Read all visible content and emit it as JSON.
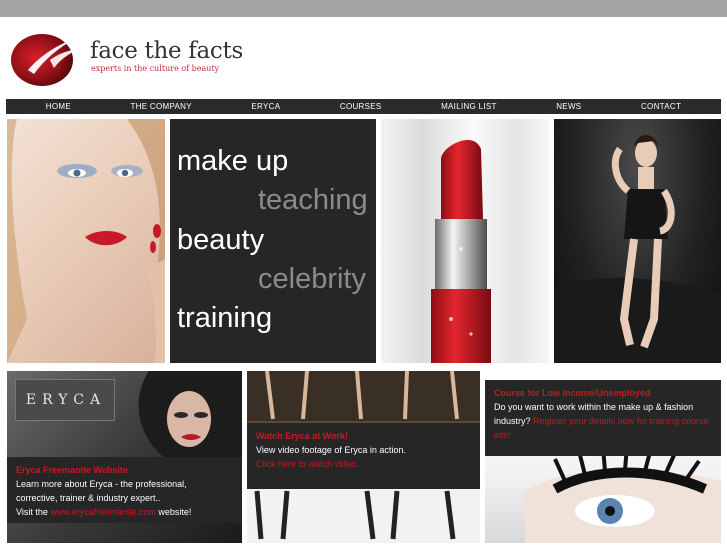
{
  "logo": {
    "title": "face the facts",
    "tagline": "experts in the culture of beauty"
  },
  "nav": {
    "items": [
      "HOME",
      "THE COMPANY",
      "ERYCA",
      "COURSES",
      "MAILING LIST",
      "NEWS",
      "CONTACT"
    ]
  },
  "hero": {
    "words": [
      "make up",
      "teaching",
      "beauty",
      "celebrity",
      "training"
    ]
  },
  "promos": {
    "eryca": {
      "badge": "ERYCA",
      "title": "Eryca Freemantle Website",
      "line1": "Learn more about Eryca - the professional,",
      "line2": "corrective, trainer & industry expert..",
      "line3_pre": "Visit the ",
      "link": "www.erycafreemantle.com",
      "line3_post": " website!"
    },
    "video": {
      "title": "Watch Eryca at Work!",
      "line1": "View video footage of Eryca in action.",
      "link": "Click here to watch video."
    },
    "course": {
      "title": "Course for Low Income/Unemployed",
      "line1": "Do you want to work within the make up & fashion",
      "line2_pre": "industry? ",
      "link": "Register your details now for training course info!"
    }
  },
  "colors": {
    "brand_red": "#c41a22",
    "nav_bg": "#2a2a2a",
    "top_bar": "#a3a3a3"
  }
}
